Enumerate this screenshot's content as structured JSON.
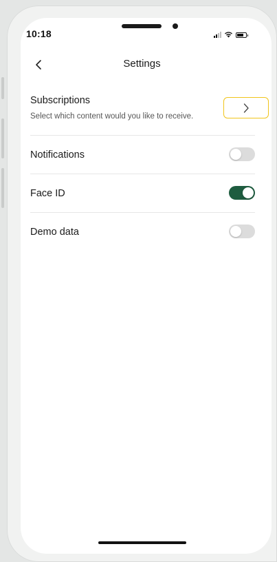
{
  "status_bar": {
    "time": "10:18"
  },
  "header": {
    "title": "Settings",
    "back_icon": "chevron-left-icon"
  },
  "settings": {
    "subscriptions": {
      "label": "Subscriptions",
      "description": "Select which content would you like to receive.",
      "action_icon": "chevron-right-icon"
    },
    "notifications": {
      "label": "Notifications",
      "enabled": false
    },
    "face_id": {
      "label": "Face ID",
      "enabled": true
    },
    "demo_data": {
      "label": "Demo data",
      "enabled": false
    }
  },
  "colors": {
    "toggle_on": "#1e5c3f",
    "toggle_off": "#dcdcdc",
    "focus_outline": "#f0c419"
  }
}
